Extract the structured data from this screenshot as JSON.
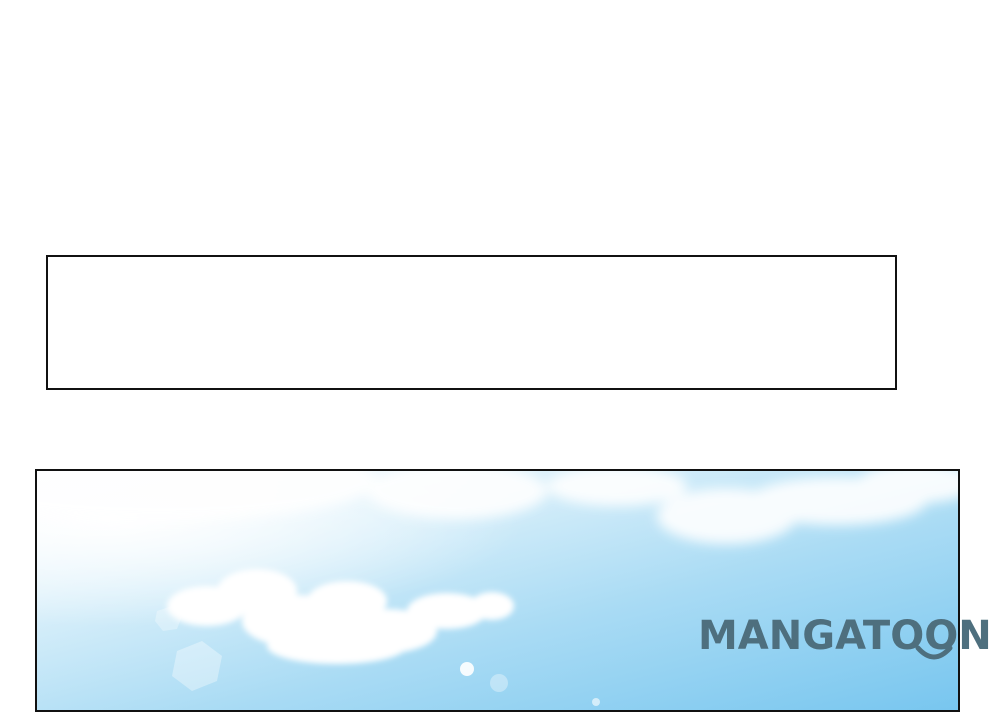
{
  "panels": {
    "top_panel": {
      "content": ""
    },
    "sky_panel": {
      "content": "sky-with-clouds"
    }
  },
  "watermark": {
    "text": "MANGATOON",
    "color": "#4e6f7e"
  },
  "colors": {
    "sky_top": "#ffffff",
    "sky_mid": "#c8e8f8",
    "sky_bottom": "#7cc7ef",
    "border": "#111111"
  }
}
